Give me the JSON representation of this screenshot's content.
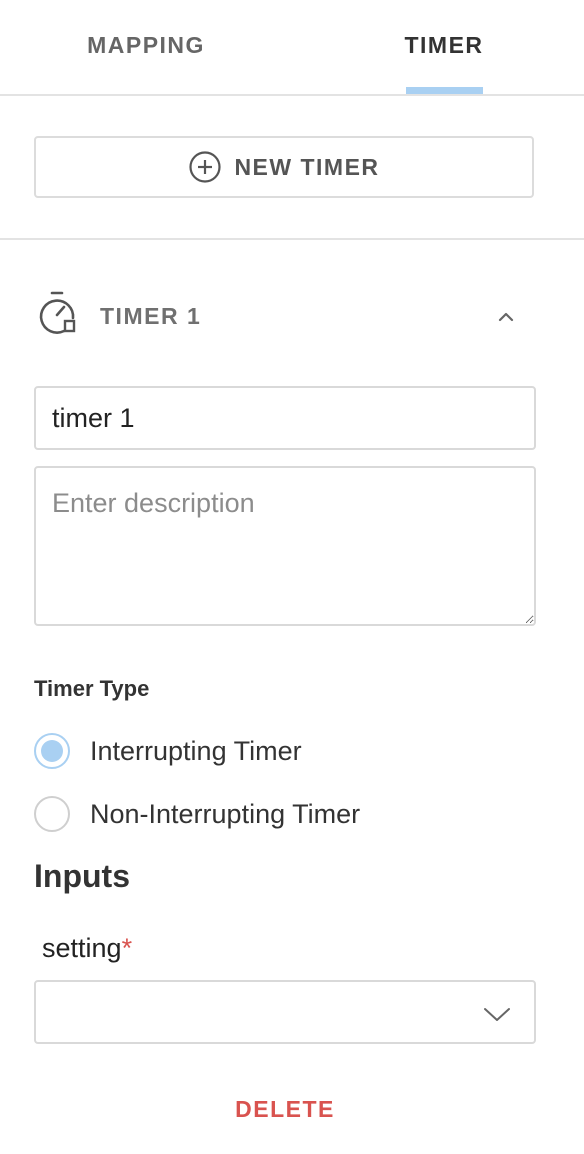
{
  "tabs": [
    {
      "label": "MAPPING",
      "active": false
    },
    {
      "label": "TIMER",
      "active": true
    }
  ],
  "new_timer_button": {
    "label": "NEW TIMER",
    "icon": "plus-circle-icon"
  },
  "timer": {
    "title": "TIMER 1",
    "icon": "timer-icon",
    "collapse_icon": "chevron-up-icon",
    "name_value": "timer 1",
    "description_placeholder": "Enter description"
  },
  "timer_type": {
    "label": "Timer Type",
    "options": [
      {
        "label": "Interrupting Timer",
        "checked": true
      },
      {
        "label": "Non-Interrupting Timer",
        "checked": false
      }
    ]
  },
  "inputs": {
    "heading": "Inputs",
    "setting_label": "setting",
    "required_marker": "*",
    "setting_value": ""
  },
  "delete_button": {
    "label": "DELETE"
  },
  "colors": {
    "accent": "#a9d0f2",
    "danger": "#d9534f",
    "border": "#d9d9d9"
  }
}
